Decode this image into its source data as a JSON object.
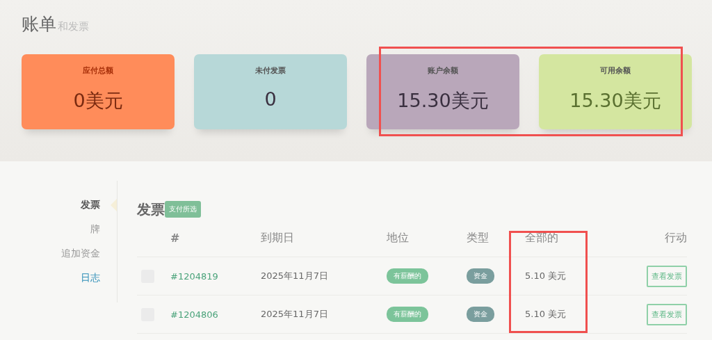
{
  "header": {
    "title": "账单",
    "subtitle": "和发票"
  },
  "cards": [
    {
      "label": "应付总额",
      "value": "0美元",
      "color": "#ff8c5a"
    },
    {
      "label": "未付发票",
      "value": "0",
      "color": "#b7d8d8"
    },
    {
      "label": "账户余额",
      "value": "15.30美元",
      "color": "#b9a7ba"
    },
    {
      "label": "可用余额",
      "value": "15.30美元",
      "color": "#d4e6a0"
    }
  ],
  "sidebar": {
    "items": [
      {
        "label": "发票",
        "selected": true,
        "kind": "item"
      },
      {
        "label": "牌",
        "selected": false,
        "kind": "item"
      },
      {
        "label": "追加资金",
        "selected": false,
        "kind": "item"
      },
      {
        "label": "日志",
        "selected": false,
        "kind": "link"
      }
    ]
  },
  "invoices": {
    "title": "发票",
    "pay_button": "支付所选",
    "columns": [
      "#",
      "到期日",
      "地位",
      "类型",
      "全部的",
      "行动"
    ],
    "rows": [
      {
        "checked": false,
        "number": "#1204819",
        "due": "2025年11月7日",
        "status": "有薪酬的",
        "type": "资金",
        "total": "5.10 美元",
        "action": "查看发票"
      },
      {
        "checked": false,
        "number": "#1204806",
        "due": "2025年11月7日",
        "status": "有薪酬的",
        "type": "资金",
        "total": "5.10 美元",
        "action": "查看发票"
      }
    ]
  }
}
